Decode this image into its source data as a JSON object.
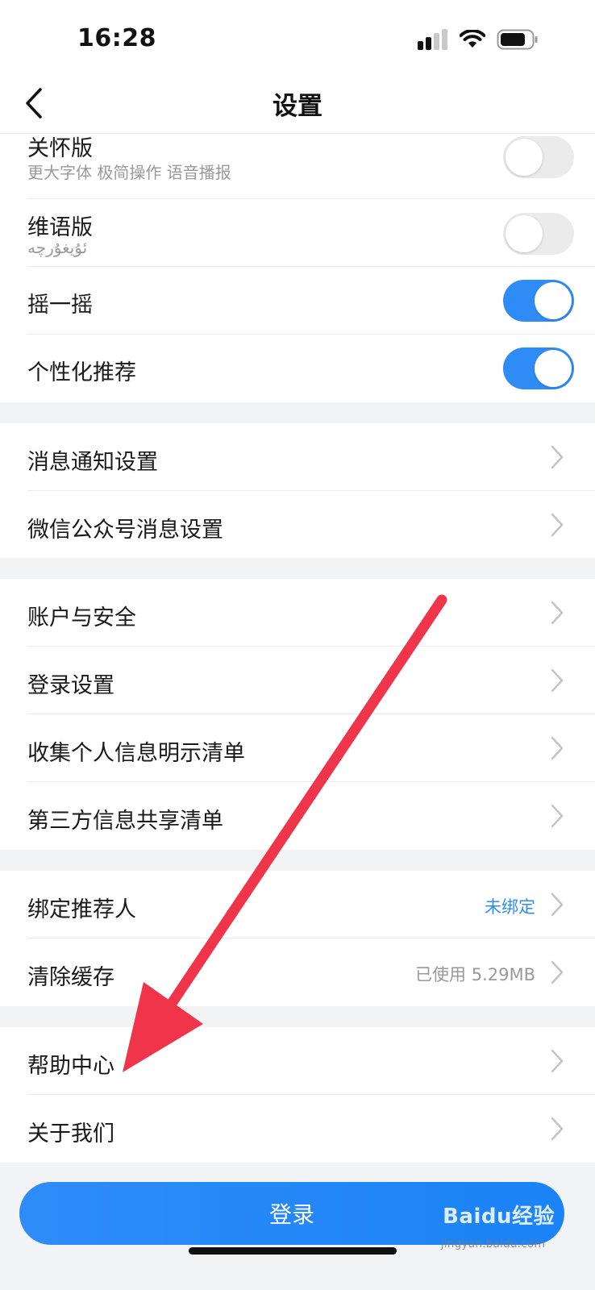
{
  "status_bar": {
    "time": "16:28"
  },
  "nav": {
    "title": "设置",
    "back_icon": "chevron-left-icon"
  },
  "settings": {
    "care_mode": {
      "title": "关怀版",
      "subtitle": "更大字体 极简操作 语音播报",
      "enabled": false
    },
    "uyghur_mode": {
      "title": "维语版",
      "subtitle": "ئۇيغۇرچە",
      "enabled": false
    },
    "shake": {
      "title": "摇一摇",
      "enabled": true
    },
    "personalized": {
      "title": "个性化推荐",
      "enabled": true
    },
    "notifications": {
      "title": "消息通知设置"
    },
    "wechat_notifications": {
      "title": "微信公众号消息设置"
    },
    "account_security": {
      "title": "账户与安全"
    },
    "login_settings": {
      "title": "登录设置"
    },
    "personal_info_list": {
      "title": "收集个人信息明示清单"
    },
    "third_party_list": {
      "title": "第三方信息共享清单"
    },
    "referrer": {
      "title": "绑定推荐人",
      "value": "未绑定",
      "value_color": "#2f8cf7"
    },
    "clear_cache": {
      "title": "清除缓存",
      "value": "已使用 5.29MB",
      "value_color": "#999999"
    },
    "help_center": {
      "title": "帮助中心"
    },
    "about_us": {
      "title": "关于我们"
    }
  },
  "login_button": {
    "label": "登录"
  },
  "watermark": {
    "brand": "Baidu经验",
    "url": "jingyan.baidu.com"
  },
  "colors": {
    "accent": "#2f8cf7",
    "arrow": "#f0344a",
    "background": "#f2f3f5"
  }
}
